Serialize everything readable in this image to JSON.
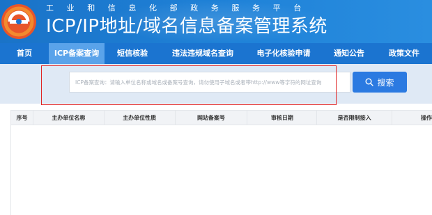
{
  "header": {
    "gov_line": "工业和信息化部政务服务平台",
    "title": "ICP/IP地址/域名信息备案管理系统"
  },
  "nav": {
    "items": [
      {
        "label": "首页",
        "active": false
      },
      {
        "label": "ICP备案查询",
        "active": true
      },
      {
        "label": "短信核验",
        "active": false
      },
      {
        "label": "违法违规域名查询",
        "active": false
      },
      {
        "label": "电子化核验申请",
        "active": false
      },
      {
        "label": "通知公告",
        "active": false
      },
      {
        "label": "政策文件",
        "active": false
      }
    ]
  },
  "search": {
    "placeholder": "ICP备案查询：请输入单位名称或域名或备案号查询，请勿使用子域名或者带http://www等字符的网址查询",
    "button_label": "搜索"
  },
  "table": {
    "headers": [
      "序号",
      "主办单位名称",
      "主办单位性质",
      "网站备案号",
      "审核日期",
      "是否限制接入",
      "操作"
    ]
  },
  "colors": {
    "brand": "#1b74d0",
    "nav_active": "#5aa3ea",
    "search_button": "#2b7ae1",
    "highlight": "#e02424"
  }
}
